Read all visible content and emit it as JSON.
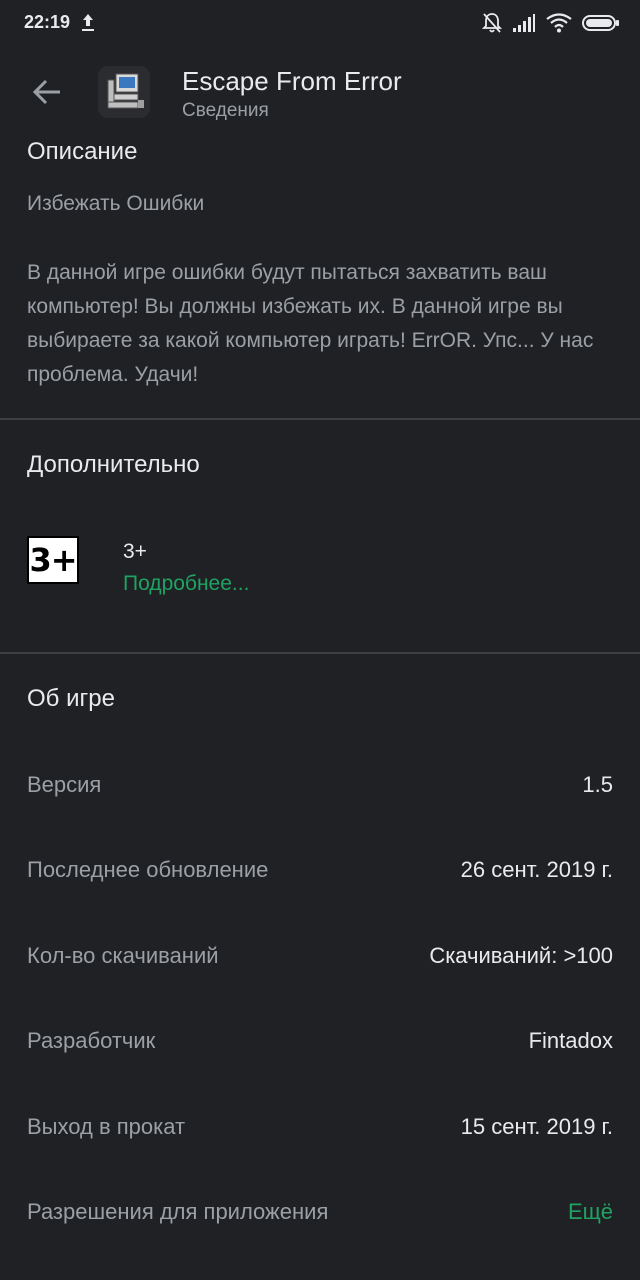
{
  "status_bar": {
    "time": "22:19",
    "icons": [
      "upload-icon",
      "bell-off-icon",
      "signal-icon",
      "wifi-icon",
      "battery-icon"
    ]
  },
  "header": {
    "title": "Escape From Error",
    "subtitle": "Сведения",
    "icons": [
      "back-arrow-icon",
      "app-computer-icon"
    ]
  },
  "description": {
    "heading": "Описание",
    "short": "Избежать Ошибки",
    "long": "В данной игре ошибки будут пытаться захватить ваш компьютер! Вы должны избежать их. В данной игре вы выбираете за какой компьютер играть! ErrOR. Упс... У нас проблема. Удачи!"
  },
  "additional": {
    "heading": "Дополнительно",
    "rating_badge": "3+",
    "rating_value": "3+",
    "rating_link": "Подробнее..."
  },
  "about": {
    "heading": "Об игре",
    "rows": [
      {
        "label": "Версия",
        "value": "1.5"
      },
      {
        "label": "Последнее обновление",
        "value": "26 сент. 2019 г."
      },
      {
        "label": "Кол-во скачиваний",
        "value": "Скачиваний: >100"
      },
      {
        "label": "Разработчик",
        "value": "Fintadox"
      },
      {
        "label": "Выход в прокат",
        "value": "15 сент. 2019 г."
      },
      {
        "label": "Разрешения для приложения",
        "value": "Ещё"
      }
    ]
  },
  "colors": {
    "background": "#202124",
    "text_primary": "#e8eaed",
    "text_secondary": "#9aa0a6",
    "accent": "#1ea362",
    "divider": "#3c4043"
  }
}
